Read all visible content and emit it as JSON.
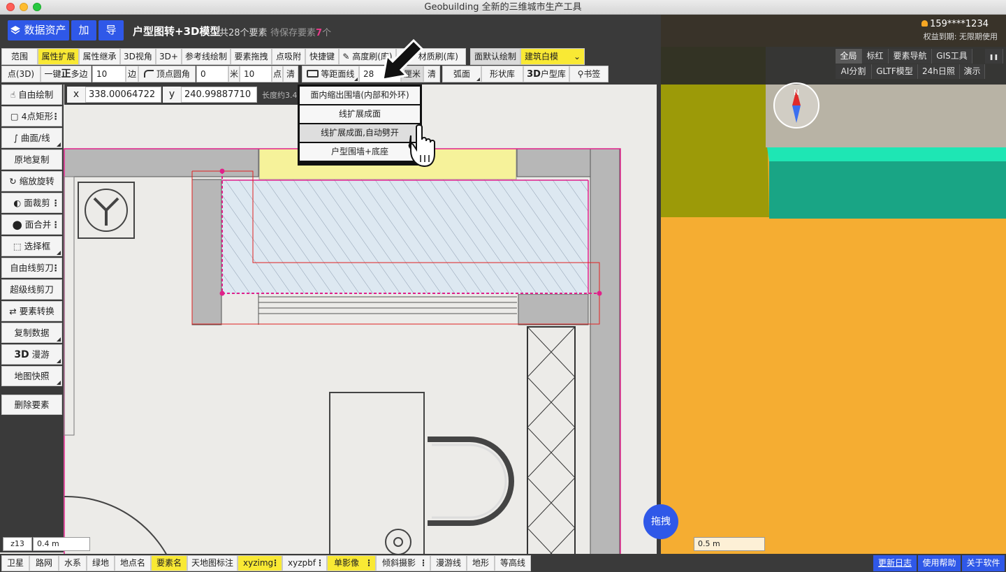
{
  "window": {
    "title": "Geobuilding 全新的三维城市生产工具"
  },
  "header": {
    "data_assets": "数据资产",
    "add": "加",
    "export": "导",
    "project_title": "户型图转+3D模型",
    "feature_count": "共28个要素",
    "pending_prefix": "待保存要素",
    "pending_count": "7",
    "pending_suffix": "个",
    "user": "159****1234",
    "rights": "权益到期: 无限期使用"
  },
  "toolbar_row1": [
    "范围",
    "属性扩展",
    "属性继承",
    "3D视角",
    "3D+",
    "参考线绘制",
    "要素拖拽",
    "点吸附",
    "快捷键",
    "高度刷(库)",
    "材质刷(库)",
    "面默认绘制",
    "建筑白模"
  ],
  "toolbar_row2": {
    "point3d": "点(3D)",
    "polygon_prefix": "一键",
    "polygon_bold": "正",
    "polygon_suffix": "多边",
    "sides": "10",
    "sides_unit": "边",
    "round_corner": "顶点圆角",
    "round_value": "0",
    "meter": "米",
    "points_value": "10",
    "points_unit": "点",
    "clear1": "清",
    "offset_line": "等距面线",
    "offset_value": "28",
    "cm": "厘米",
    "clear2": "清",
    "arc": "弧面",
    "shape_lib": "形状库",
    "lib3d_bold": "3D",
    "lib3d": "户型库",
    "bookmark": "书签"
  },
  "right_tabs_row1": [
    "全局",
    "标红",
    "要素导航",
    "GIS工具"
  ],
  "right_tabs_row2": [
    "AI分割",
    "GLTF模型",
    "24h日照",
    "演示"
  ],
  "left_tools": [
    "自由绘制",
    "4点矩形",
    "曲面/线",
    "原地复制",
    "缩放旋转",
    "面裁剪",
    "面合并",
    "选择框",
    "自由线剪刀",
    "超级线剪刀",
    "要素转换",
    "复制数据",
    "漫游",
    "地图快照",
    "删除要素"
  ],
  "left_tools_bold_prefix": "3D",
  "coords": {
    "x_label": "x",
    "x_value": "338.00064722",
    "y_label": "y",
    "y_value": "240.99887710",
    "length_label": "长度约3.4"
  },
  "dropdown": [
    "面内缩出围墙(内部和外环)",
    "线扩展成面",
    "线扩展成面,自动劈开",
    "户型围墙+底座"
  ],
  "bottom_bar": [
    "卫星",
    "路网",
    "水系",
    "绿地",
    "地点名",
    "要素名",
    "天地图标注",
    "xyzimg",
    "xyzpbf",
    "单影像",
    "倾斜摄影",
    "漫游线",
    "地形",
    "等高线"
  ],
  "bottom_right": [
    "更新日志",
    "使用帮助",
    "关于软件"
  ],
  "map": {
    "zoom": "z13",
    "scale_2d": "0.4 m",
    "scale_3d": "0.5 m",
    "drag": "拖拽",
    "compass_n": "N"
  },
  "colors": {
    "accent_blue": "#2f58e8",
    "highlight_yellow": "#f9e934",
    "selection_magenta": "#e0218a",
    "building_orange": "#f5ad32",
    "building_teal": "#19a585"
  }
}
